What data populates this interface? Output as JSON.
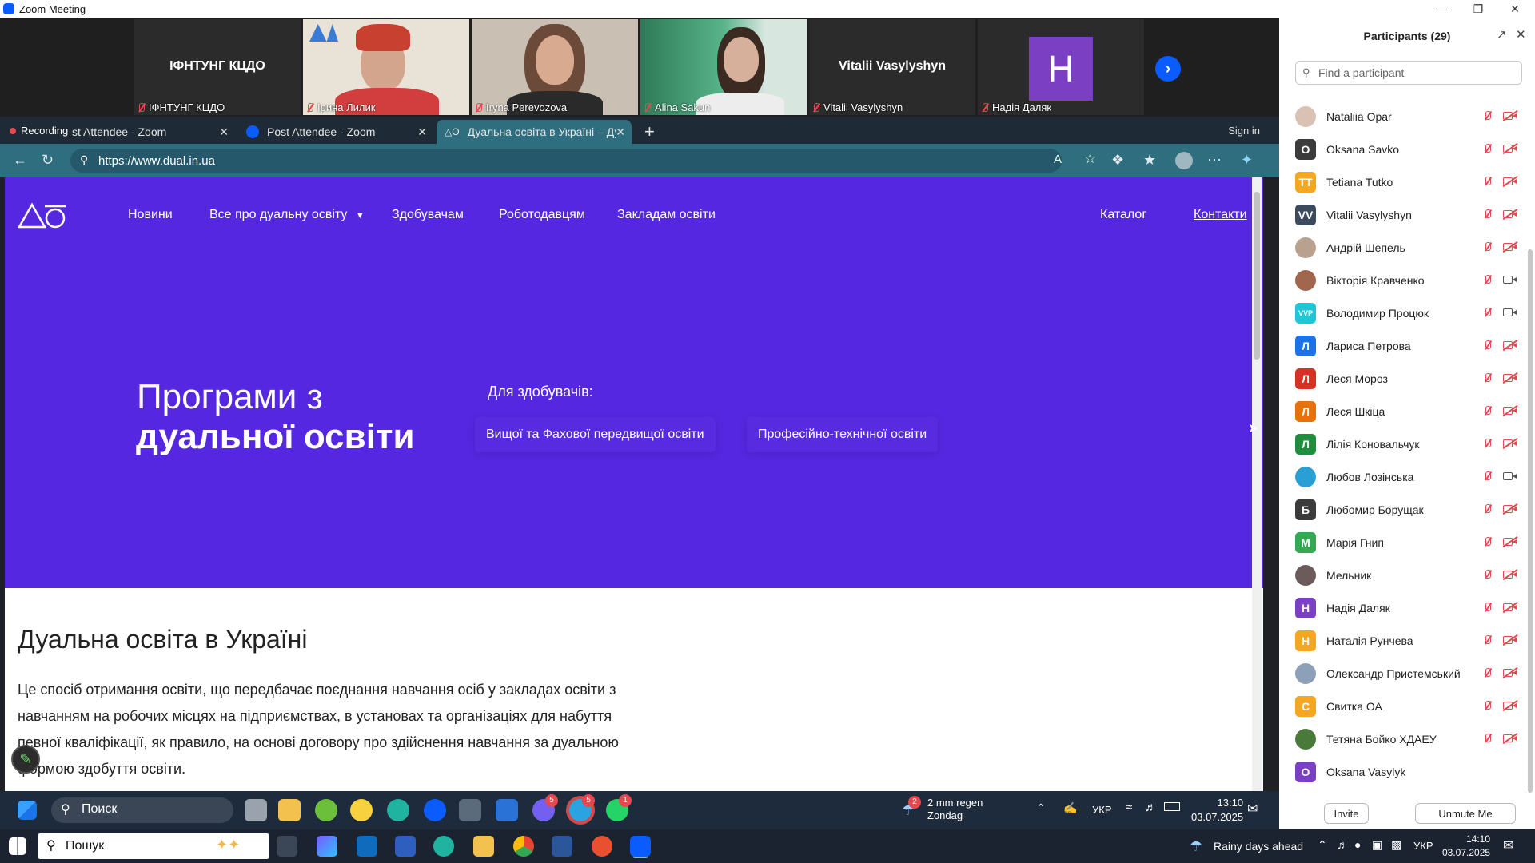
{
  "zoom": {
    "title": "Zoom Meeting"
  },
  "video_tiles": [
    {
      "name": "ІФНТУНГ КЦДО",
      "label": "ІФНТУНГ КЦДО",
      "video": false
    },
    {
      "name": "",
      "label": "Ірина Лилик",
      "video": true
    },
    {
      "name": "",
      "label": "Iryna Perevozova",
      "video": true
    },
    {
      "name": "",
      "label": "Alina Sakun",
      "video": true
    },
    {
      "name": "Vitalii Vasylyshyn",
      "label": "Vitalii Vasylyshyn",
      "video": false
    },
    {
      "name": "H",
      "label": "Надія Даляк",
      "video": false,
      "avatar_color": "#7b3fc4"
    }
  ],
  "browser": {
    "recording_label": "Recording",
    "tabs": [
      {
        "label": "st Attendee - Zoom"
      },
      {
        "label": "Post Attendee - Zoom"
      },
      {
        "label": "Дуальна освіта в Україні – Дуал"
      }
    ],
    "signin": "Sign in",
    "url": "https://www.dual.in.ua"
  },
  "site": {
    "nav": [
      {
        "label": "Новини"
      },
      {
        "label": "Все про дуальну освіту"
      },
      {
        "label": "Здобувачам"
      },
      {
        "label": "Роботодавцям"
      },
      {
        "label": "Закладам освіти"
      }
    ],
    "nav_right": [
      {
        "label": "Каталог"
      },
      {
        "label": "Контакти"
      }
    ],
    "hero_title_line1": "Програми з",
    "hero_title_line2": "дуальної освіти",
    "for_students": "Для здобувачів:",
    "programs": [
      {
        "label": "Вищої та Фахової передвищої освіти"
      },
      {
        "label": "Професійно-технічної освіти"
      }
    ],
    "section_title": "Дуальна освіта в Україні",
    "section_body": "Це спосіб отримання освіти, що передбачає поєднання навчання осіб у закладах освіти з навчанням на робочих місцях на підприємствах, в установах та організаціях для набуття певної кваліфікації, як правило, на основі договору про здійснення навчання за дуальною формою здобуття освіти.",
    "colors": {
      "hero_bg": "#5527e0",
      "accent": "#ffffff"
    }
  },
  "inner_taskbar": {
    "search": "Поиск",
    "weather_line1": "2 mm regen",
    "weather_line2": "Zondag",
    "weather_badge": "2",
    "lang": "УКР",
    "time": "13:10",
    "date": "03.07.2025",
    "badges": {
      "viber": "5",
      "telegram": "5",
      "whatsapp": "1"
    }
  },
  "participants": {
    "title": "Participants (29)",
    "search_placeholder": "Find a participant",
    "list": [
      {
        "name": "Nataliia Opar",
        "initials": "",
        "color": "#d9c2b3",
        "photo": true,
        "cam": "off"
      },
      {
        "name": "Oksana Savko",
        "initials": "O",
        "color": "#3b3b3b",
        "cam": "off"
      },
      {
        "name": "Tetiana Tutko",
        "initials": "TT",
        "color": "#f5a623",
        "cam": "off"
      },
      {
        "name": "Vitalii Vasylyshyn",
        "initials": "VV",
        "color": "#3b4a5c",
        "cam": "off"
      },
      {
        "name": "Андрій Шепель",
        "initials": "",
        "color": "#b9a08f",
        "photo": true,
        "cam": "off"
      },
      {
        "name": "Вікторія Кравченко",
        "initials": "",
        "color": "#a0664e",
        "photo": true,
        "cam": "on"
      },
      {
        "name": "Володимир Процюк",
        "initials": "VVP",
        "color": "#1fc7d4",
        "cam": "on"
      },
      {
        "name": "Лариса Петрова",
        "initials": "Л",
        "color": "#1a73e8",
        "cam": "off"
      },
      {
        "name": "Леся Мороз",
        "initials": "Л",
        "color": "#d93025",
        "cam": "off"
      },
      {
        "name": "Леся Шкіца",
        "initials": "Л",
        "color": "#e8710a",
        "cam": "off"
      },
      {
        "name": "Лілія Коновальчук",
        "initials": "Л",
        "color": "#1e8e3e",
        "cam": "off"
      },
      {
        "name": "Любов Лозінська",
        "initials": "",
        "color": "#2a9fd6",
        "photo": true,
        "cam": "on"
      },
      {
        "name": "Любомир Борущак",
        "initials": "Б",
        "color": "#3b3b3b",
        "cam": "off"
      },
      {
        "name": "Марія Гнип",
        "initials": "М",
        "color": "#34a853",
        "cam": "off"
      },
      {
        "name": "Мельник",
        "initials": "",
        "color": "#6b5b5b",
        "photo": true,
        "cam": "off"
      },
      {
        "name": "Надія Даляк",
        "initials": "Н",
        "color": "#7b3fc4",
        "cam": "off"
      },
      {
        "name": "Наталія Рунчева",
        "initials": "Н",
        "color": "#f5a623",
        "cam": "off"
      },
      {
        "name": "Олександр Пристемський",
        "initials": "",
        "color": "#8ca0b8",
        "photo": true,
        "cam": "off"
      },
      {
        "name": "Свитка ОА",
        "initials": "С",
        "color": "#f5a623",
        "cam": "off"
      },
      {
        "name": "Тетяна Бойко ХДАЕУ",
        "initials": "",
        "color": "#4a7a3a",
        "photo": true,
        "cam": "off"
      },
      {
        "name": "Oksana Vasylyk",
        "initials": "O",
        "color": "#7b3fc4",
        "cam": "none"
      }
    ],
    "invite": "Invite",
    "unmute": "Unmute Me"
  },
  "os_taskbar": {
    "search": "Пошук",
    "weather": "Rainy days ahead",
    "lang": "УКР",
    "time": "14:10",
    "date": "03.07.2025"
  }
}
